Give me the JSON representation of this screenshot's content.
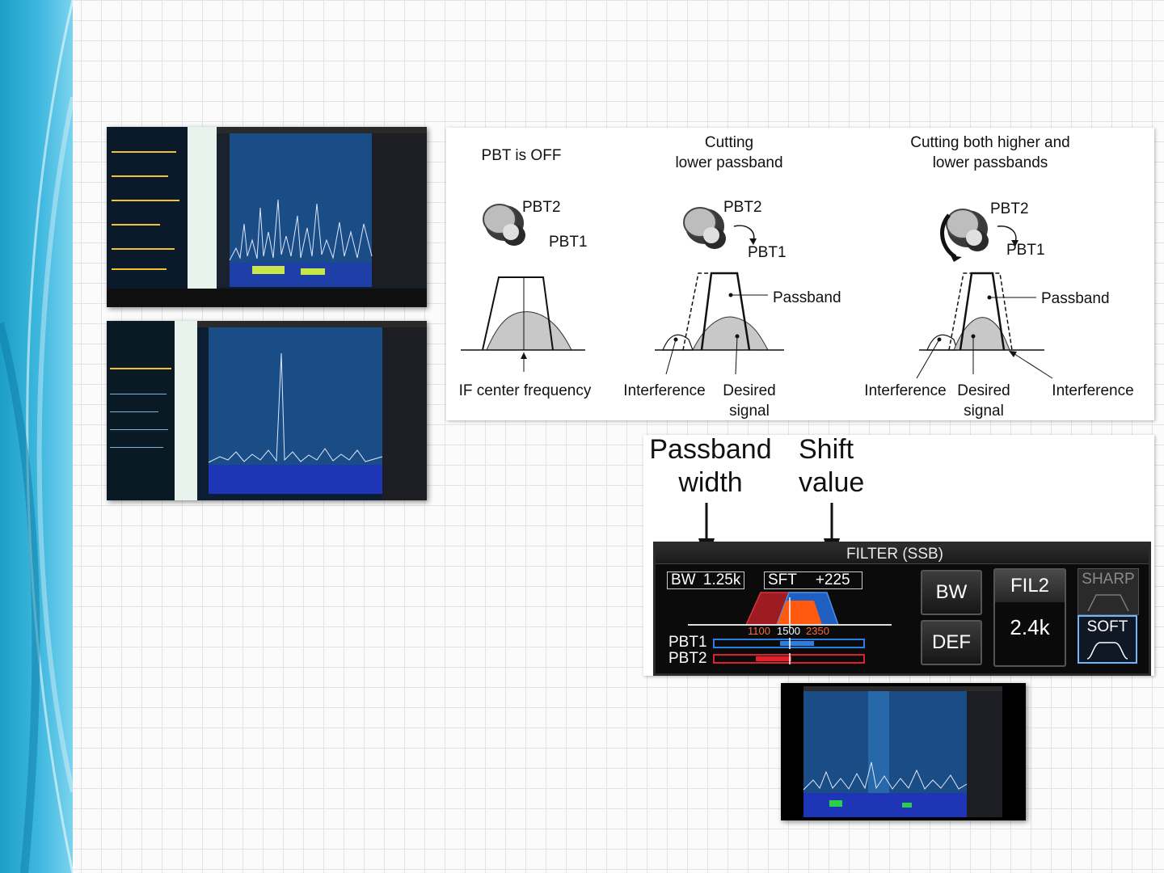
{
  "diagram": {
    "col1": {
      "title": "PBT is OFF",
      "pbt2": "PBT2",
      "pbt1": "PBT1",
      "caption": "IF center frequency"
    },
    "col2": {
      "title_line1": "Cutting",
      "title_line2": "lower passband",
      "pbt2": "PBT2",
      "pbt1": "PBT1",
      "passband": "Passband",
      "interference": "Interference",
      "desired_line1": "Desired",
      "desired_line2": "signal"
    },
    "col3": {
      "title_line1": "Cutting both higher and",
      "title_line2": "lower passbands",
      "pbt2": "PBT2",
      "pbt1": "PBT1",
      "passband": "Passband",
      "interference_left": "Interference",
      "desired_line1": "Desired",
      "desired_line2": "signal",
      "interference_right": "Interference"
    }
  },
  "callouts": {
    "passband_line1": "Passband",
    "passband_line2": "width",
    "shift_line1": "Shift",
    "shift_line2": "value"
  },
  "filter": {
    "title": "FILTER (SSB)",
    "bw_label": "BW",
    "bw_value": "1.25k",
    "sft_label": "SFT",
    "sft_value": "+225",
    "scale": [
      "1100",
      "1500",
      "2350"
    ],
    "pbt1": "PBT1",
    "pbt2": "PBT2",
    "buttons": {
      "bw": "BW",
      "def": "DEF",
      "fil2": "FIL2",
      "fil2_value": "2.4k",
      "sharp": "SHARP",
      "soft": "SOFT"
    }
  },
  "colors": {
    "pbt1": "#2a7fe0",
    "pbt2": "#e0202a",
    "passband_orange": "#ff5a10",
    "shape_blue": "#1f6fd8",
    "shape_red": "#c81e28",
    "sidebar": "#2aaad6"
  }
}
